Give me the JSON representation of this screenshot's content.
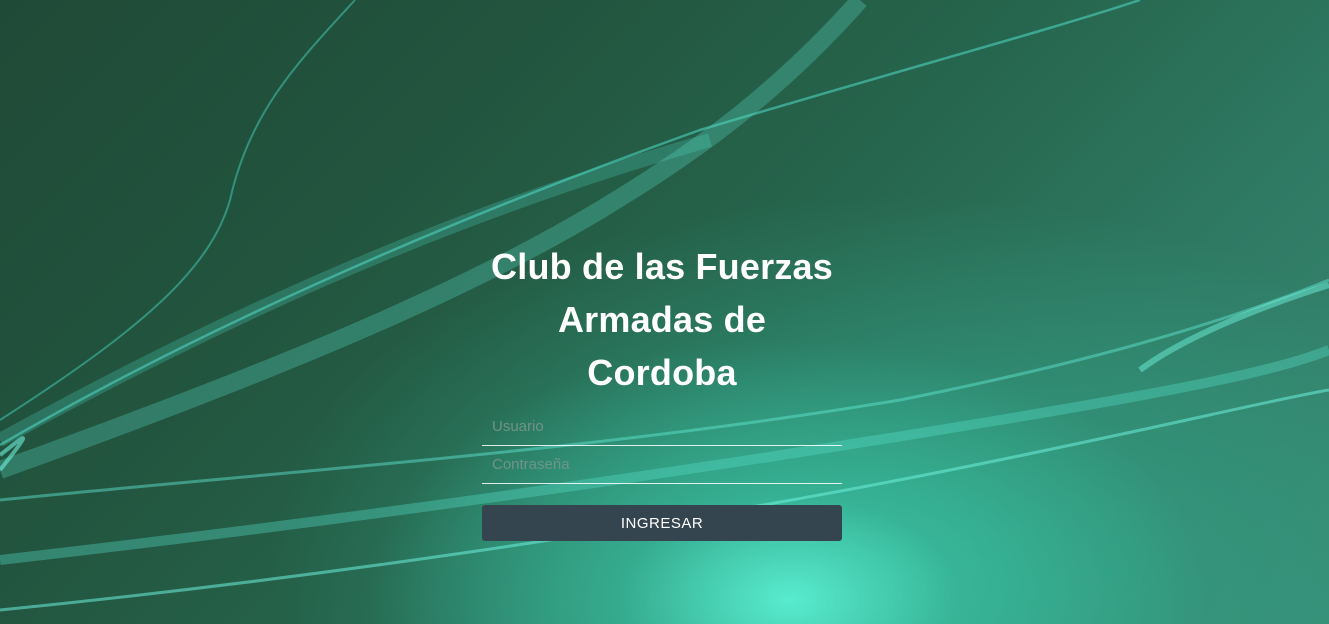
{
  "login": {
    "title": "Club de las Fuerzas Armadas de Cordoba",
    "username_placeholder": "Usuario",
    "username_value": "",
    "password_placeholder": "Contraseña",
    "password_value": "",
    "submit_label": "INGRESAR"
  },
  "colors": {
    "background_dark": "#1f4a37",
    "background_glow": "#5af0d2",
    "wave_accent": "#3ad8c0",
    "button": "#34454f",
    "title_text": "#ffffff"
  }
}
